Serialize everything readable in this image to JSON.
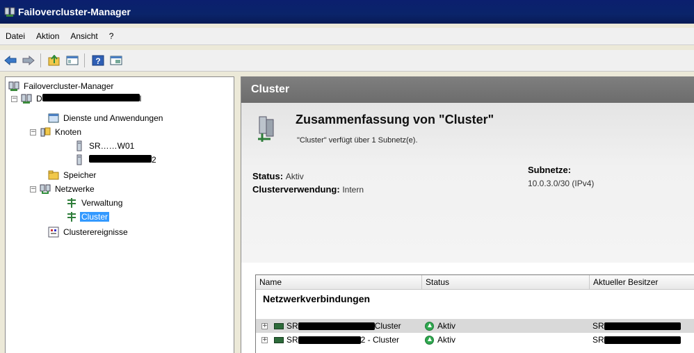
{
  "window": {
    "title": "Failovercluster-Manager",
    "icon": "cluster-manager-icon"
  },
  "menu": [
    "Datei",
    "Aktion",
    "Ansicht",
    "?"
  ],
  "toolbar": {
    "buttons": [
      "back-icon",
      "forward-icon",
      "up-folder-icon",
      "show-hide-tree-icon",
      "help-icon",
      "properties-icon"
    ]
  },
  "tree": {
    "root": "Failovercluster-Manager",
    "cluster_prefix": "D",
    "cluster_suffix": "l",
    "services": "Dienste und Anwendungen",
    "nodes": "Knoten",
    "node1": "SR……W01",
    "node2_suffix": "2",
    "storage": "Speicher",
    "networks": "Netzwerke",
    "net_admin": "Verwaltung",
    "net_cluster": "Cluster",
    "events": "Clusterereignisse"
  },
  "main": {
    "header": "Cluster",
    "summary_title": "Zusammenfassung von \"Cluster\"",
    "summary_sub": "\"Cluster\" verfügt über 1 Subnetz(e).",
    "status_label": "Status:",
    "status_value": "Aktiv",
    "usage_label": "Clusterverwendung:",
    "usage_value": "Intern",
    "subnets_label": "Subnetze:",
    "subnets_value": "10.0.3.0/30 (IPv4)"
  },
  "grid": {
    "columns": [
      "Name",
      "Status",
      "Aktueller Besitzer"
    ],
    "group": "Netzwerkverbindungen",
    "rows": [
      {
        "name_prefix": "SR",
        "name_suffix": "Cluster",
        "status": "Aktiv",
        "owner_prefix": "SR"
      },
      {
        "name_prefix": "SR",
        "name_suffix": "2 - Cluster",
        "status": "Aktiv",
        "owner_prefix": "SR"
      }
    ]
  },
  "colors": {
    "titlebar": "#0a246a",
    "selection": "#3399ff",
    "header": "#737373",
    "status_ok": "#2fa84f"
  }
}
